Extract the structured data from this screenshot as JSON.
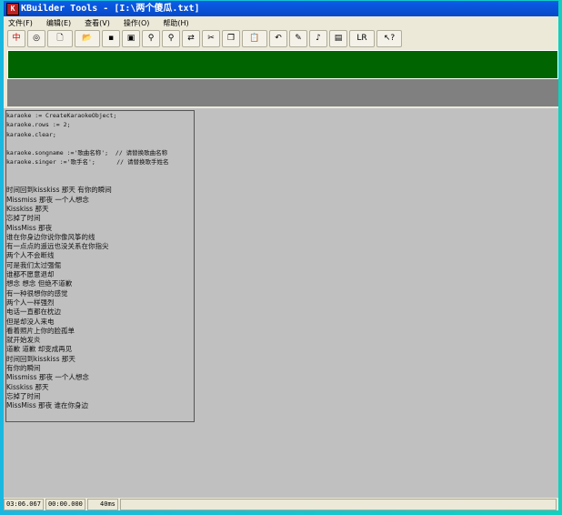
{
  "window": {
    "title": "KBuilder Tools - [I:\\两个傻瓜.txt]",
    "logo": "K"
  },
  "menu": [
    "文件(F)",
    "编辑(E)",
    "查看(V)",
    "操作(O)",
    "帮助(H)"
  ],
  "toolbar": [
    {
      "name": "chinese-button",
      "glyph": "中",
      "color": "#c00000"
    },
    {
      "name": "disc-button",
      "glyph": "◎"
    },
    {
      "name": "new-file-button",
      "glyph": "🗋"
    },
    {
      "name": "open-folder-button",
      "glyph": "📂"
    },
    {
      "name": "save-button",
      "glyph": "▪"
    },
    {
      "name": "film-button",
      "glyph": "▣"
    },
    {
      "name": "find-button",
      "glyph": "⚲"
    },
    {
      "name": "find-next-button",
      "glyph": "⚲"
    },
    {
      "name": "replace-button",
      "glyph": "⇄"
    },
    {
      "name": "cut-button",
      "glyph": "✂"
    },
    {
      "name": "copy-button",
      "glyph": "❐"
    },
    {
      "name": "paste-button",
      "glyph": "📋"
    },
    {
      "name": "undo-button",
      "glyph": "↶"
    },
    {
      "name": "highlight-button",
      "glyph": "✎"
    },
    {
      "name": "karaoke-button",
      "glyph": "♪"
    },
    {
      "name": "preview-button",
      "glyph": "▤"
    },
    {
      "name": "lr-button",
      "glyph": "LR"
    },
    {
      "name": "help-button",
      "glyph": "↖?"
    }
  ],
  "code": [
    "karaoke := CreateKaraokeObject;",
    "karaoke.rows := 2;",
    "karaoke.clear;",
    "",
    "karaoke.songname :='歌曲名称';  // 请替换歌曲名称",
    "karaoke.singer :='歌手名';      // 请替换歌手姓名",
    "",
    ""
  ],
  "lyrics": [
    "时间回到kisskiss 那天 有你的瞬间",
    "Missmiss 那夜 一个人想念",
    "Kisskiss 那天",
    "忘掉了时间",
    "MissMiss 那夜",
    "谁在你身边你说你像风筝的线",
    "有一点点的遥远也没关系在你指尖",
    "两个人不会断线",
    "可是我们太过强倔",
    "谁都不愿意退却",
    "想念 想念 但绝不道歉",
    "有一种很想你的感觉",
    "两个人一样强烈",
    "电话一直都在枕边",
    "但是却没人来电",
    "看着照片上你的脸孤单",
    "就开始发炎",
    "道歉 道歉 却变成再见",
    "时间回到kisskiss 那天",
    "有你的瞬间",
    "Missmiss 那夜 一个人想念",
    "Kisskiss 那天",
    "忘掉了时间",
    "MissMiss 那夜 谁在你身边"
  ],
  "status": {
    "total": "03:06.067",
    "current": "00:00.000",
    "interval": "40ms"
  }
}
